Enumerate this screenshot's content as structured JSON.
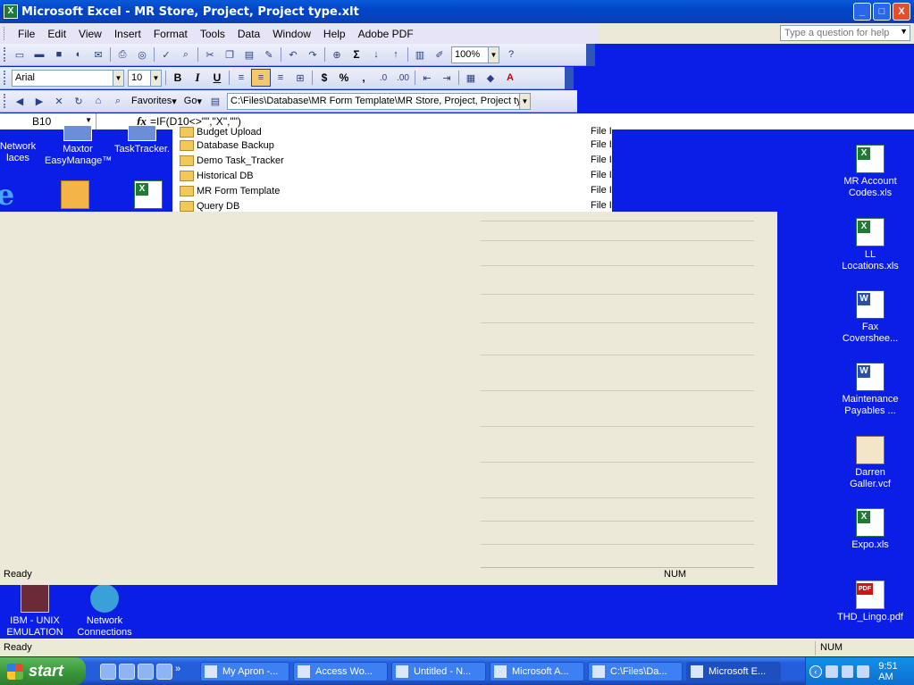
{
  "window": {
    "title": "Microsoft Excel - MR Store, Project, Project type.xlt",
    "controls": [
      "_",
      "□",
      "X"
    ]
  },
  "menu": {
    "items": [
      "File",
      "Edit",
      "View",
      "Insert",
      "Format",
      "Tools",
      "Data",
      "Window",
      "Help",
      "Adobe PDF"
    ],
    "help_placeholder": "Type a question for help"
  },
  "standard_toolbar": {
    "zoom": "100%"
  },
  "formatting_toolbar": {
    "font": "Arial",
    "size": "10",
    "bold": "B",
    "italic": "I",
    "underline": "U",
    "currency": "$",
    "percent": "%",
    "comma": ","
  },
  "web_toolbar": {
    "favorites": "Favorites",
    "go": "Go",
    "address": "C:\\Files\\Database\\MR Form Template\\MR Store, Project, Project ty"
  },
  "formula_bar": {
    "name_box": "B10",
    "fx": "fx",
    "formula": "=IF(D10<>\"\",\"X\",\"\")"
  },
  "desktop_icons_left": [
    {
      "label": "Network\nlaces"
    },
    {
      "label": "Maxtor\nEasyManage™"
    },
    {
      "label": "TaskTracker."
    },
    {
      "label": "IBM - UNIX\nEMULATION"
    },
    {
      "label": "Network\nConnections"
    }
  ],
  "desktop_icons_right": [
    {
      "label": "MR Account\nCodes.xls",
      "icon": "excel-file-icon"
    },
    {
      "label": "LL\nLocations.xls",
      "icon": "excel-file-icon"
    },
    {
      "label": "Fax\nCovershee...",
      "icon": "word-file-icon"
    },
    {
      "label": "Maintenance\nPayables ...",
      "icon": "word-file-icon"
    },
    {
      "label": "Darren\nGaller.vcf",
      "icon": "vcard-file-icon"
    },
    {
      "label": "Expo.xls",
      "icon": "excel-file-icon"
    },
    {
      "label": "THD_Lingo.pdf",
      "icon": "pdf-file-icon"
    }
  ],
  "explorer": {
    "folders": [
      "Budget Upload",
      "Database Backup",
      "Demo Task_Tracker",
      "Historical DB",
      "MR Form Template",
      "Query DB"
    ],
    "type_label": "File I"
  },
  "ghost": {
    "ready": "Ready",
    "num": "NUM"
  },
  "statusbar": {
    "ready": "Ready",
    "num": "NUM"
  },
  "taskbar": {
    "start": "start",
    "tasks": [
      "My Apron -...",
      "Access Wo...",
      "Untitled - N...",
      "Microsoft A...",
      "C:\\Files\\Da...",
      "Microsoft E..."
    ],
    "active_index": 5,
    "clock": "9:51 AM"
  }
}
